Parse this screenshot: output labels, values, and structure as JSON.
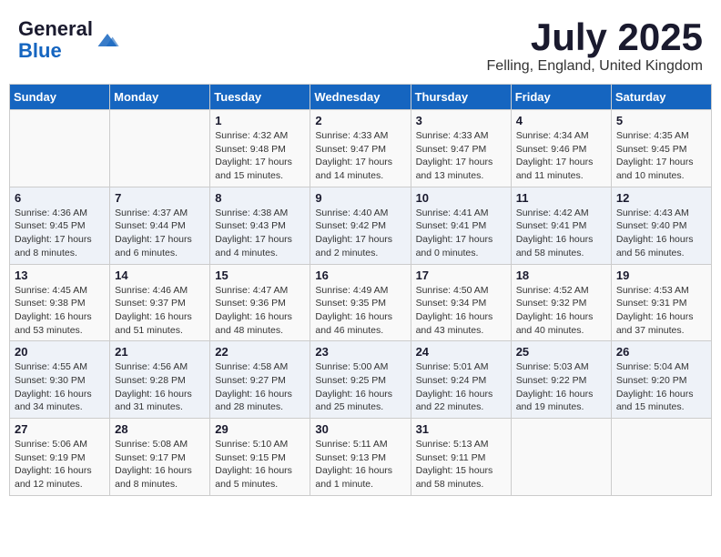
{
  "header": {
    "logo_general": "General",
    "logo_blue": "Blue",
    "month_title": "July 2025",
    "location": "Felling, England, United Kingdom"
  },
  "calendar": {
    "days_of_week": [
      "Sunday",
      "Monday",
      "Tuesday",
      "Wednesday",
      "Thursday",
      "Friday",
      "Saturday"
    ],
    "weeks": [
      [
        {
          "day": "",
          "sunrise": "",
          "sunset": "",
          "daylight": ""
        },
        {
          "day": "",
          "sunrise": "",
          "sunset": "",
          "daylight": ""
        },
        {
          "day": "1",
          "sunrise": "Sunrise: 4:32 AM",
          "sunset": "Sunset: 9:48 PM",
          "daylight": "Daylight: 17 hours and 15 minutes."
        },
        {
          "day": "2",
          "sunrise": "Sunrise: 4:33 AM",
          "sunset": "Sunset: 9:47 PM",
          "daylight": "Daylight: 17 hours and 14 minutes."
        },
        {
          "day": "3",
          "sunrise": "Sunrise: 4:33 AM",
          "sunset": "Sunset: 9:47 PM",
          "daylight": "Daylight: 17 hours and 13 minutes."
        },
        {
          "day": "4",
          "sunrise": "Sunrise: 4:34 AM",
          "sunset": "Sunset: 9:46 PM",
          "daylight": "Daylight: 17 hours and 11 minutes."
        },
        {
          "day": "5",
          "sunrise": "Sunrise: 4:35 AM",
          "sunset": "Sunset: 9:45 PM",
          "daylight": "Daylight: 17 hours and 10 minutes."
        }
      ],
      [
        {
          "day": "6",
          "sunrise": "Sunrise: 4:36 AM",
          "sunset": "Sunset: 9:45 PM",
          "daylight": "Daylight: 17 hours and 8 minutes."
        },
        {
          "day": "7",
          "sunrise": "Sunrise: 4:37 AM",
          "sunset": "Sunset: 9:44 PM",
          "daylight": "Daylight: 17 hours and 6 minutes."
        },
        {
          "day": "8",
          "sunrise": "Sunrise: 4:38 AM",
          "sunset": "Sunset: 9:43 PM",
          "daylight": "Daylight: 17 hours and 4 minutes."
        },
        {
          "day": "9",
          "sunrise": "Sunrise: 4:40 AM",
          "sunset": "Sunset: 9:42 PM",
          "daylight": "Daylight: 17 hours and 2 minutes."
        },
        {
          "day": "10",
          "sunrise": "Sunrise: 4:41 AM",
          "sunset": "Sunset: 9:41 PM",
          "daylight": "Daylight: 17 hours and 0 minutes."
        },
        {
          "day": "11",
          "sunrise": "Sunrise: 4:42 AM",
          "sunset": "Sunset: 9:41 PM",
          "daylight": "Daylight: 16 hours and 58 minutes."
        },
        {
          "day": "12",
          "sunrise": "Sunrise: 4:43 AM",
          "sunset": "Sunset: 9:40 PM",
          "daylight": "Daylight: 16 hours and 56 minutes."
        }
      ],
      [
        {
          "day": "13",
          "sunrise": "Sunrise: 4:45 AM",
          "sunset": "Sunset: 9:38 PM",
          "daylight": "Daylight: 16 hours and 53 minutes."
        },
        {
          "day": "14",
          "sunrise": "Sunrise: 4:46 AM",
          "sunset": "Sunset: 9:37 PM",
          "daylight": "Daylight: 16 hours and 51 minutes."
        },
        {
          "day": "15",
          "sunrise": "Sunrise: 4:47 AM",
          "sunset": "Sunset: 9:36 PM",
          "daylight": "Daylight: 16 hours and 48 minutes."
        },
        {
          "day": "16",
          "sunrise": "Sunrise: 4:49 AM",
          "sunset": "Sunset: 9:35 PM",
          "daylight": "Daylight: 16 hours and 46 minutes."
        },
        {
          "day": "17",
          "sunrise": "Sunrise: 4:50 AM",
          "sunset": "Sunset: 9:34 PM",
          "daylight": "Daylight: 16 hours and 43 minutes."
        },
        {
          "day": "18",
          "sunrise": "Sunrise: 4:52 AM",
          "sunset": "Sunset: 9:32 PM",
          "daylight": "Daylight: 16 hours and 40 minutes."
        },
        {
          "day": "19",
          "sunrise": "Sunrise: 4:53 AM",
          "sunset": "Sunset: 9:31 PM",
          "daylight": "Daylight: 16 hours and 37 minutes."
        }
      ],
      [
        {
          "day": "20",
          "sunrise": "Sunrise: 4:55 AM",
          "sunset": "Sunset: 9:30 PM",
          "daylight": "Daylight: 16 hours and 34 minutes."
        },
        {
          "day": "21",
          "sunrise": "Sunrise: 4:56 AM",
          "sunset": "Sunset: 9:28 PM",
          "daylight": "Daylight: 16 hours and 31 minutes."
        },
        {
          "day": "22",
          "sunrise": "Sunrise: 4:58 AM",
          "sunset": "Sunset: 9:27 PM",
          "daylight": "Daylight: 16 hours and 28 minutes."
        },
        {
          "day": "23",
          "sunrise": "Sunrise: 5:00 AM",
          "sunset": "Sunset: 9:25 PM",
          "daylight": "Daylight: 16 hours and 25 minutes."
        },
        {
          "day": "24",
          "sunrise": "Sunrise: 5:01 AM",
          "sunset": "Sunset: 9:24 PM",
          "daylight": "Daylight: 16 hours and 22 minutes."
        },
        {
          "day": "25",
          "sunrise": "Sunrise: 5:03 AM",
          "sunset": "Sunset: 9:22 PM",
          "daylight": "Daylight: 16 hours and 19 minutes."
        },
        {
          "day": "26",
          "sunrise": "Sunrise: 5:04 AM",
          "sunset": "Sunset: 9:20 PM",
          "daylight": "Daylight: 16 hours and 15 minutes."
        }
      ],
      [
        {
          "day": "27",
          "sunrise": "Sunrise: 5:06 AM",
          "sunset": "Sunset: 9:19 PM",
          "daylight": "Daylight: 16 hours and 12 minutes."
        },
        {
          "day": "28",
          "sunrise": "Sunrise: 5:08 AM",
          "sunset": "Sunset: 9:17 PM",
          "daylight": "Daylight: 16 hours and 8 minutes."
        },
        {
          "day": "29",
          "sunrise": "Sunrise: 5:10 AM",
          "sunset": "Sunset: 9:15 PM",
          "daylight": "Daylight: 16 hours and 5 minutes."
        },
        {
          "day": "30",
          "sunrise": "Sunrise: 5:11 AM",
          "sunset": "Sunset: 9:13 PM",
          "daylight": "Daylight: 16 hours and 1 minute."
        },
        {
          "day": "31",
          "sunrise": "Sunrise: 5:13 AM",
          "sunset": "Sunset: 9:11 PM",
          "daylight": "Daylight: 15 hours and 58 minutes."
        },
        {
          "day": "",
          "sunrise": "",
          "sunset": "",
          "daylight": ""
        },
        {
          "day": "",
          "sunrise": "",
          "sunset": "",
          "daylight": ""
        }
      ]
    ]
  }
}
